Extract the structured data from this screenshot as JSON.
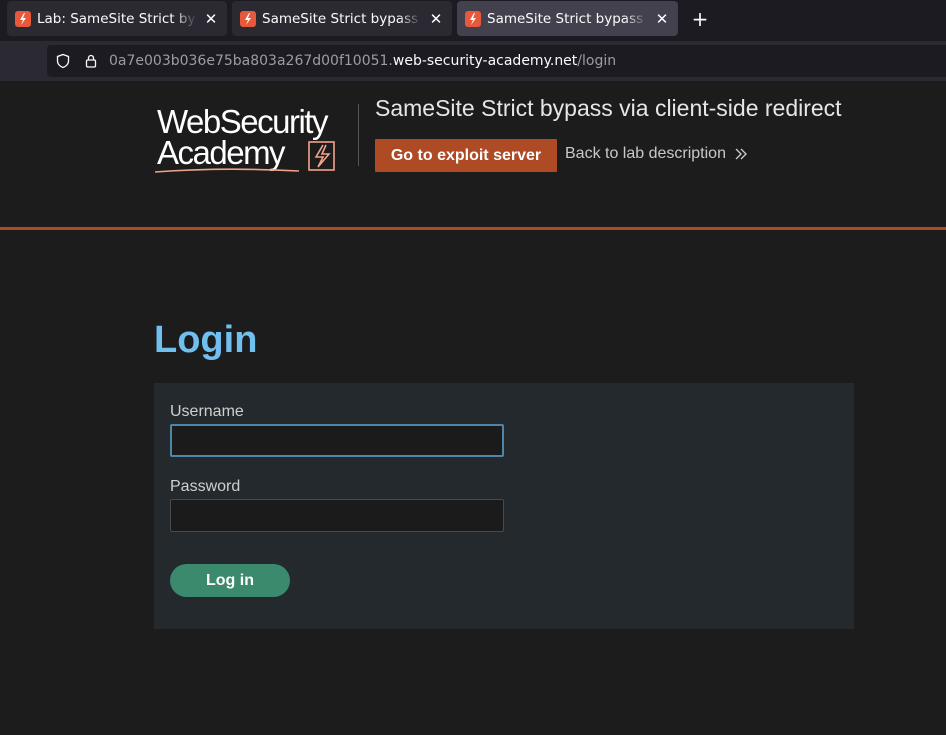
{
  "browser": {
    "tabs": [
      {
        "title": "Lab: SameSite Strict bypass via client-side redirect",
        "active": false
      },
      {
        "title": "SameSite Strict bypass via client-side redirect",
        "active": false
      },
      {
        "title": "SameSite Strict bypass via client-side redirect",
        "active": true
      }
    ],
    "new_tab_label": "+",
    "close_label": "✕",
    "url": {
      "prefix": "0a7e003b036e75ba803a267d00f10051.",
      "domain": "web-security-academy.net",
      "path": "/login"
    }
  },
  "header": {
    "logo_line1": "WebSecurity",
    "logo_line2": "Academy",
    "lab_title": "SameSite Strict bypass via client-side redirect",
    "exploit_button": "Go to exploit server",
    "back_link": "Back to lab description"
  },
  "login": {
    "title": "Login",
    "username_label": "Username",
    "username_value": "",
    "password_label": "Password",
    "password_value": "",
    "submit_label": "Log in"
  },
  "colors": {
    "accent_orange": "#ae4a24",
    "login_title_blue": "#70bfef",
    "login_button_green": "#3b8a6e",
    "panel_bg": "#23292c"
  }
}
